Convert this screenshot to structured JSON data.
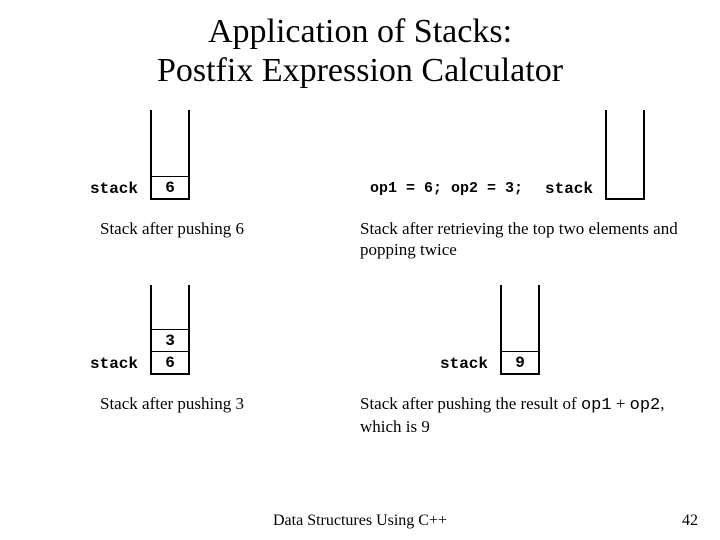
{
  "title_line1": "Application of Stacks:",
  "title_line2": "Postfix Expression Calculator",
  "stacks": {
    "s1": {
      "label": "stack",
      "cells": [
        "6"
      ]
    },
    "s2": {
      "label": "stack",
      "cells": [
        "6",
        "3"
      ]
    },
    "s3": {
      "op_text": "op1 = 6; op2 = 3;",
      "label": "stack",
      "cells": []
    },
    "s4": {
      "label": "stack",
      "cells": [
        "9"
      ]
    }
  },
  "captions": {
    "c1": "Stack after pushing 6",
    "c2": "Stack after pushing 3",
    "c3": "Stack after retrieving the top two elements and popping twice",
    "c4_pre": "Stack after pushing the result of ",
    "c4_op1": "op1",
    "c4_mid": " + ",
    "c4_op2": "op2",
    "c4_post": ", which is 9"
  },
  "footer": "Data Structures Using C++",
  "page": "42"
}
